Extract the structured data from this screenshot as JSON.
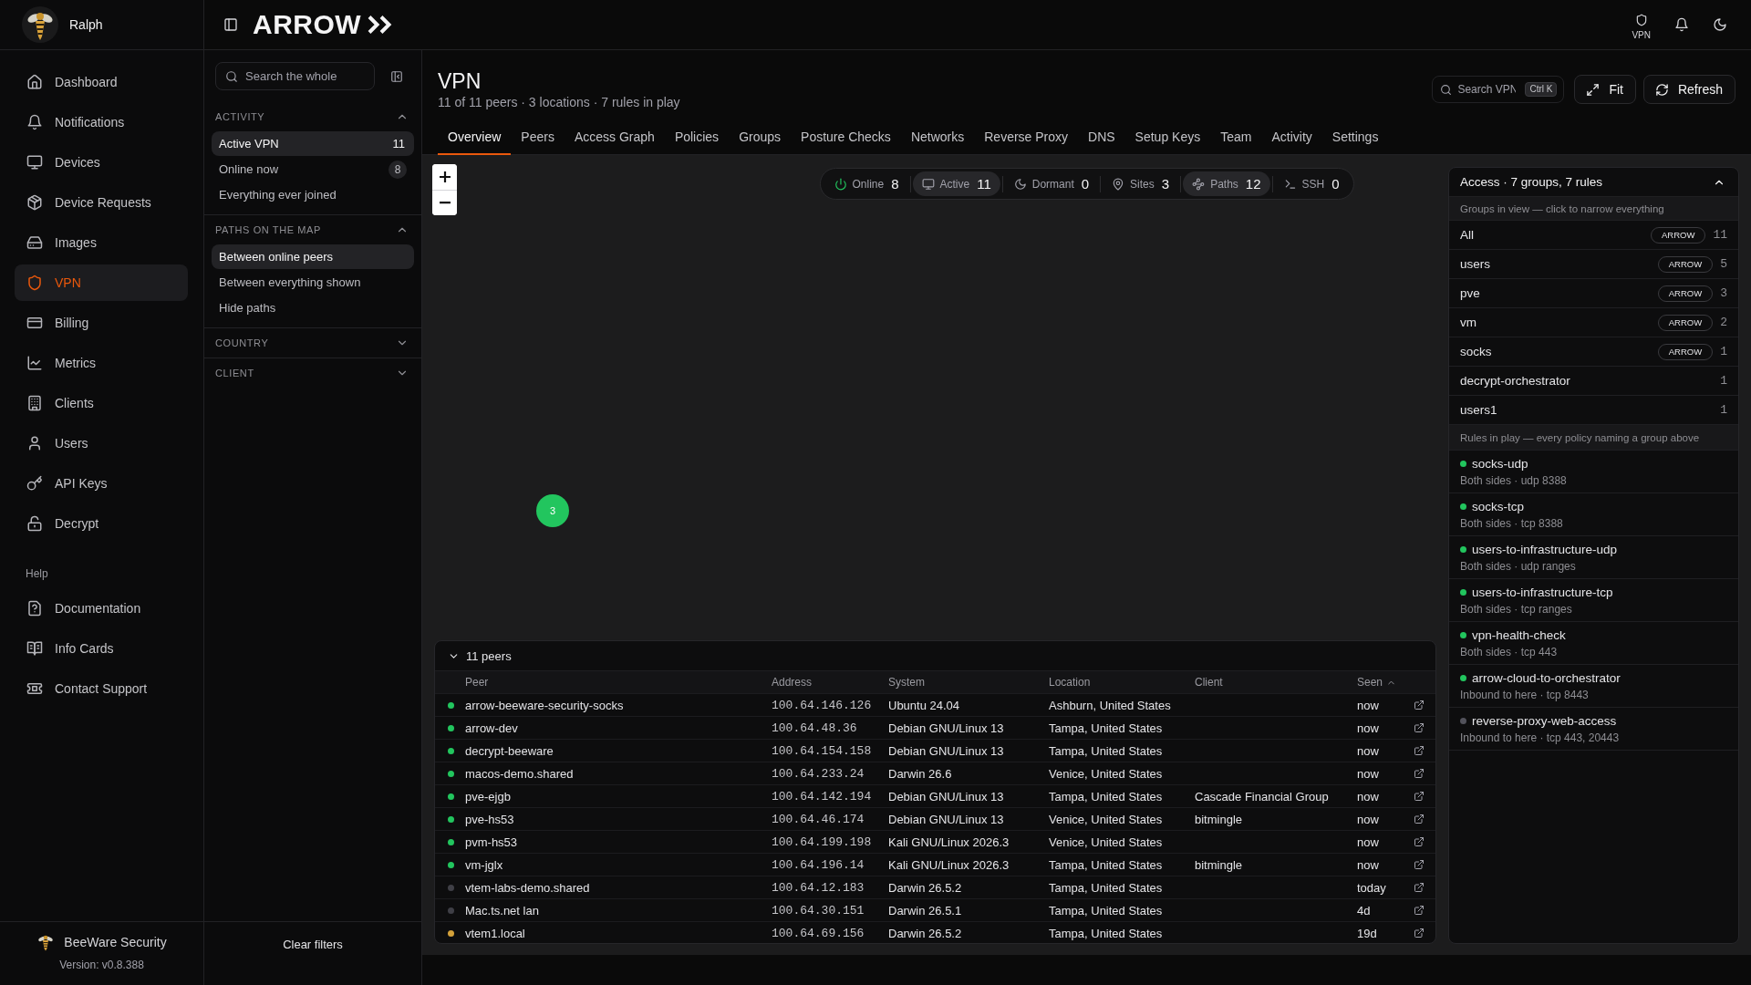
{
  "sidebar": {
    "account": {
      "name": "Ralph"
    },
    "nav": [
      {
        "label": "Dashboard",
        "selected": false
      },
      {
        "label": "Notifications",
        "selected": false
      },
      {
        "label": "Devices",
        "selected": false
      },
      {
        "label": "Device Requests",
        "selected": false
      },
      {
        "label": "Images",
        "selected": false
      },
      {
        "label": "VPN",
        "selected": true
      },
      {
        "label": "Billing",
        "selected": false
      },
      {
        "label": "Metrics",
        "selected": false
      },
      {
        "label": "Clients",
        "selected": false
      },
      {
        "label": "Users",
        "selected": false
      },
      {
        "label": "API Keys",
        "selected": false
      },
      {
        "label": "Decrypt",
        "selected": false
      }
    ],
    "help_heading": "Help",
    "help": [
      {
        "label": "Documentation",
        "selected": false
      },
      {
        "label": "Info Cards",
        "selected": false
      },
      {
        "label": "Contact Support",
        "selected": false
      }
    ],
    "footer": {
      "org": "BeeWare Security",
      "version": "Version: v0.8.388"
    }
  },
  "topbar": {
    "logo": "ARROW",
    "status": {
      "label": "VPN"
    }
  },
  "filters": {
    "search": {
      "placeholder": "Search the whole"
    },
    "sections": [
      {
        "title": "ACTIVITY",
        "expanded": true,
        "options": [
          {
            "label": "Active VPN",
            "count": "11",
            "selected": true
          },
          {
            "label": "Online now",
            "count": "8",
            "selected": false
          },
          {
            "label": "Everything ever joined",
            "selected": false
          }
        ]
      },
      {
        "title": "PATHS ON THE MAP",
        "expanded": true,
        "options": [
          {
            "label": "Between online peers",
            "selected": true
          },
          {
            "label": "Between everything shown",
            "selected": false
          },
          {
            "label": "Hide paths",
            "selected": false
          }
        ]
      },
      {
        "title": "COUNTRY",
        "expanded": false
      },
      {
        "title": "CLIENT",
        "expanded": false
      }
    ],
    "clear_button": "Clear filters"
  },
  "page": {
    "title": "VPN",
    "subtitle": "11 of 11 peers · 3 locations · 7 rules in play",
    "search": {
      "placeholder": "Search VPN",
      "shortcut": "Ctrl K"
    },
    "buttons": [
      {
        "label": "Fit"
      },
      {
        "label": "Refresh"
      }
    ]
  },
  "tabs": [
    {
      "label": "Overview",
      "selected": true
    },
    {
      "label": "Peers",
      "selected": false
    },
    {
      "label": "Access Graph",
      "selected": false
    },
    {
      "label": "Policies",
      "selected": false
    },
    {
      "label": "Groups",
      "selected": false
    },
    {
      "label": "Posture Checks",
      "selected": false
    },
    {
      "label": "Networks",
      "selected": false
    },
    {
      "label": "Reverse Proxy",
      "selected": false
    },
    {
      "label": "DNS",
      "selected": false
    },
    {
      "label": "Setup Keys",
      "selected": false
    },
    {
      "label": "Team",
      "selected": false
    },
    {
      "label": "Activity",
      "selected": false
    },
    {
      "label": "Settings",
      "selected": false
    }
  ],
  "map": {
    "stats": [
      {
        "label": "Online",
        "value": "8",
        "selected": false
      },
      {
        "label": "Active",
        "value": "11",
        "selected": true
      },
      {
        "label": "Dormant",
        "value": "0",
        "selected": false
      },
      {
        "label": "Sites",
        "value": "3",
        "selected": false
      },
      {
        "label": "Paths",
        "value": "12",
        "selected": true
      },
      {
        "label": "SSH",
        "value": "0",
        "selected": false
      }
    ],
    "clusters": [
      {
        "count": "3"
      }
    ]
  },
  "peers": {
    "title": "11 peers",
    "expanded": true,
    "columns": [
      {
        "label": "Peer",
        "sorted": false
      },
      {
        "label": "Address",
        "sorted": false
      },
      {
        "label": "System",
        "sorted": false
      },
      {
        "label": "Location",
        "sorted": false
      },
      {
        "label": "Client",
        "sorted": false
      },
      {
        "label": "Seen",
        "sorted": true
      }
    ],
    "rows": [
      {
        "color": "#22c55e",
        "peer": "arrow-beeware-security-socks",
        "address": "100.64.146.126",
        "system": "Ubuntu 24.04",
        "location": "Ashburn, United States",
        "seen": "now"
      },
      {
        "color": "#22c55e",
        "peer": "arrow-dev",
        "address": "100.64.48.36",
        "system": "Debian GNU/Linux 13",
        "location": "Tampa, United States",
        "seen": "now"
      },
      {
        "color": "#22c55e",
        "peer": "decrypt-beeware",
        "address": "100.64.154.158",
        "system": "Debian GNU/Linux 13",
        "location": "Tampa, United States",
        "seen": "now"
      },
      {
        "color": "#22c55e",
        "peer": "macos-demo.shared",
        "address": "100.64.233.24",
        "system": "Darwin 26.6",
        "location": "Venice, United States",
        "seen": "now"
      },
      {
        "color": "#22c55e",
        "peer": "pve-ejgb",
        "address": "100.64.142.194",
        "system": "Debian GNU/Linux 13",
        "location": "Tampa, United States",
        "client": "Cascade Financial Group",
        "seen": "now"
      },
      {
        "color": "#22c55e",
        "peer": "pve-hs53",
        "address": "100.64.46.174",
        "system": "Debian GNU/Linux 13",
        "location": "Venice, United States",
        "client": "bitmingle",
        "seen": "now"
      },
      {
        "color": "#22c55e",
        "peer": "pvm-hs53",
        "address": "100.64.199.198",
        "system": "Kali GNU/Linux 2026.3",
        "location": "Venice, United States",
        "seen": "now"
      },
      {
        "color": "#22c55e",
        "peer": "vm-jglx",
        "address": "100.64.196.14",
        "system": "Kali GNU/Linux 2026.3",
        "location": "Tampa, United States",
        "client": "bitmingle",
        "seen": "now"
      },
      {
        "color": "#3f3f46",
        "peer": "vtem-labs-demo.shared",
        "address": "100.64.12.183",
        "system": "Darwin 26.5.2",
        "location": "Tampa, United States",
        "seen": "today"
      },
      {
        "color": "#3f3f46",
        "peer": "Mac.ts.net lan",
        "address": "100.64.30.151",
        "system": "Darwin 26.5.1",
        "location": "Tampa, United States",
        "seen": "4d"
      },
      {
        "color": "#d4a13a",
        "peer": "vtem1.local",
        "address": "100.64.69.156",
        "system": "Darwin 26.5.2",
        "location": "Tampa, United States",
        "seen": "19d"
      }
    ]
  },
  "access": {
    "title": "Access · 7 groups, 7 rules",
    "expanded": true,
    "groups_hint": "Groups in view — click to narrow everything",
    "groups": [
      {
        "name": "All",
        "tag": "ARROW",
        "count": "11"
      },
      {
        "name": "users",
        "tag": "ARROW",
        "count": "5"
      },
      {
        "name": "pve",
        "tag": "ARROW",
        "count": "3"
      },
      {
        "name": "vm",
        "tag": "ARROW",
        "count": "2"
      },
      {
        "name": "socks",
        "tag": "ARROW",
        "count": "1"
      },
      {
        "name": "decrypt-orchestrator",
        "count": "1"
      },
      {
        "name": "users1",
        "count": "1"
      }
    ],
    "rules_hint": "Rules in play — every policy naming a group above",
    "rules": [
      {
        "name": "socks-udp",
        "detail": "Both sides · udp 8388",
        "color": "#22c55e"
      },
      {
        "name": "socks-tcp",
        "detail": "Both sides · tcp 8388",
        "color": "#22c55e"
      },
      {
        "name": "users-to-infrastructure-udp",
        "detail": "Both sides · udp ranges",
        "color": "#22c55e"
      },
      {
        "name": "users-to-infrastructure-tcp",
        "detail": "Both sides · tcp ranges",
        "color": "#22c55e"
      },
      {
        "name": "vpn-health-check",
        "detail": "Both sides · tcp 443",
        "color": "#22c55e"
      },
      {
        "name": "arrow-cloud-to-orchestrator",
        "detail": "Inbound to here · tcp 8443",
        "color": "#22c55e"
      },
      {
        "name": "reverse-proxy-web-access",
        "detail": "Inbound to here · tcp 443, 20443",
        "color": "#52525b"
      }
    ]
  }
}
